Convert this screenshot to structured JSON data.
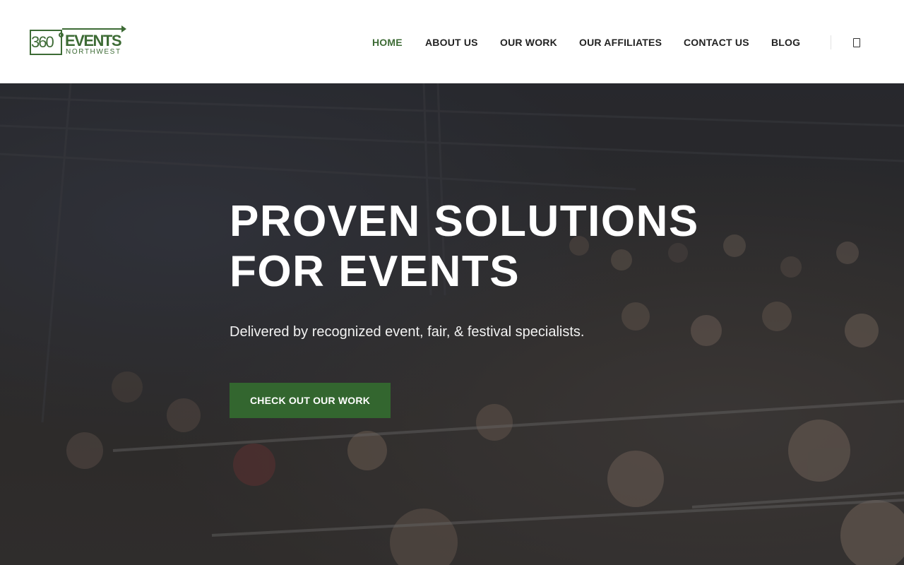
{
  "brand": {
    "logo_number": "360",
    "logo_word": "EVENTS",
    "logo_sub": "NORTHWEST",
    "color_primary": "#3d6b35",
    "color_button": "#33662f"
  },
  "nav": {
    "items": [
      {
        "label": "HOME",
        "active": true
      },
      {
        "label": "ABOUT US",
        "active": false
      },
      {
        "label": "OUR WORK",
        "active": false
      },
      {
        "label": "OUR AFFILIATES",
        "active": false
      },
      {
        "label": "CONTACT US",
        "active": false
      },
      {
        "label": "BLOG",
        "active": false
      }
    ],
    "cart_icon": "shopping-cart-icon"
  },
  "hero": {
    "title_line1": "PROVEN SOLUTIONS",
    "title_line2": "FOR EVENTS",
    "subtitle": "Delivered by recognized event, fair, & festival specialists.",
    "button_label": "CHECK OUT OUR WORK",
    "background": "stadium crowd photo"
  }
}
